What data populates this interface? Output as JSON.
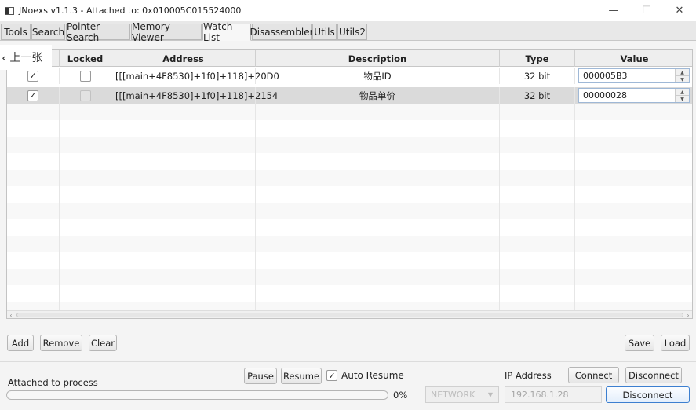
{
  "window": {
    "title": "JNoexs v1.1.3 - Attached to: 0x010005C015524000",
    "minimize": "—",
    "maximize": "☐",
    "close": "✕"
  },
  "tabs": [
    {
      "label": "Tools"
    },
    {
      "label": "Search"
    },
    {
      "label": "Pointer Search"
    },
    {
      "label": "Memory Viewer"
    },
    {
      "label": "Watch List",
      "active": true
    },
    {
      "label": "Disassembler"
    },
    {
      "label": "Utils"
    },
    {
      "label": "Utils2"
    }
  ],
  "overlay": {
    "prev_label": "上一张"
  },
  "table": {
    "columns": [
      "",
      "Locked",
      "Address",
      "Description",
      "Type",
      "Value"
    ],
    "rows": [
      {
        "checked": true,
        "locked": false,
        "address": "[[[main+4F8530]+1f0]+118]+20D0",
        "description": "物品ID",
        "type": "32 bit",
        "value": "000005B3"
      },
      {
        "checked": true,
        "locked": false,
        "address": "[[[main+4F8530]+1f0]+118]+2154",
        "description": "物品单价",
        "type": "32 bit",
        "value": "00000028"
      }
    ]
  },
  "list_buttons": {
    "add": "Add",
    "remove": "Remove",
    "clear": "Clear",
    "save": "Save",
    "load": "Load"
  },
  "status": {
    "text": "Attached to process",
    "progress_percent": "0%",
    "progress_value": 0
  },
  "controls": {
    "pause": "Pause",
    "resume": "Resume",
    "auto_resume_label": "Auto Resume",
    "auto_resume_checked": true,
    "ip_label": "IP Address",
    "connect": "Connect",
    "disconnect_top": "Disconnect",
    "network_combo": "NETWORK",
    "ip_value": "192.168.1.28",
    "disconnect_bottom": "Disconnect"
  }
}
